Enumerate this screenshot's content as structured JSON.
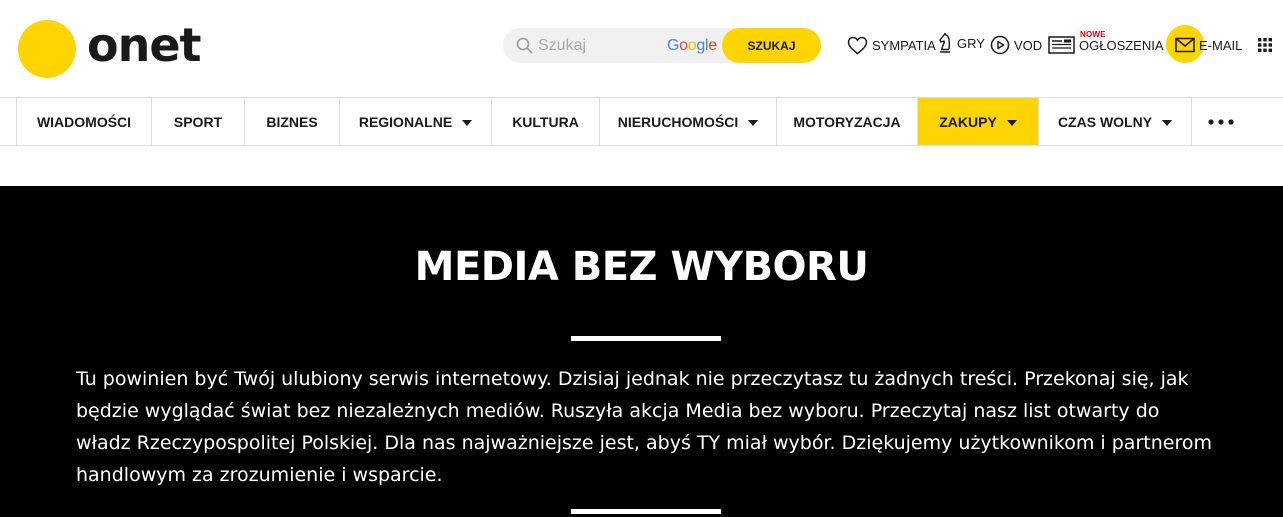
{
  "header": {
    "logo_text": "onet",
    "search": {
      "placeholder": "Szukaj",
      "google": [
        {
          "ch": "G",
          "color": "#4285F4"
        },
        {
          "ch": "o",
          "color": "#EA4335"
        },
        {
          "ch": "o",
          "color": "#FBBC05"
        },
        {
          "ch": "g",
          "color": "#4285F4"
        },
        {
          "ch": "l",
          "color": "#34A853"
        },
        {
          "ch": "e",
          "color": "#EA4335"
        }
      ],
      "button_label": "SZUKAJ"
    },
    "links": {
      "sympatia": "SYMPATIA",
      "gry": "GRY",
      "vod": "VOD",
      "ogloszenia": "OGŁOSZENIA",
      "ogloszenia_badge": "NOWE",
      "email": "E-MAIL"
    }
  },
  "nav": {
    "items": [
      {
        "label": "WIADOMOŚCI"
      },
      {
        "label": "SPORT"
      },
      {
        "label": "BIZNES"
      },
      {
        "label": "REGIONALNE"
      },
      {
        "label": "KULTURA"
      },
      {
        "label": "NIERUCHOMOŚCI"
      },
      {
        "label": "MOTORYZACJA"
      },
      {
        "label": "ZAKUPY"
      },
      {
        "label": "CZAS WOLNY"
      }
    ]
  },
  "banner": {
    "title": "MEDIA BEZ WYBORU",
    "text": "Tu powinien być Twój ulubiony serwis internetowy. Dzisiaj jednak nie przeczytasz tu żadnych treści. Przekonaj się, jak będzie wyglądać świat bez niezależnych mediów. Ruszyła akcja Media bez wyboru. Przeczytaj nasz list otwarty do władz Rzeczypospolitej Polskiej. Dla nas najważniejsze jest, abyś TY miał wybór. Dziękujemy użytkownikom i partnerom handlowym za zrozumienie i wsparcie."
  },
  "colors": {
    "brand_yellow": "#FFD400",
    "banner_bg": "#000000",
    "badge_red": "#E2001A"
  },
  "icons": [
    "search-icon",
    "heart-icon",
    "chess-knight-icon",
    "play-circle-icon",
    "newspaper-icon",
    "envelope-icon",
    "apps-grid-icon",
    "more-dots-icon",
    "caret-down-icon"
  ]
}
